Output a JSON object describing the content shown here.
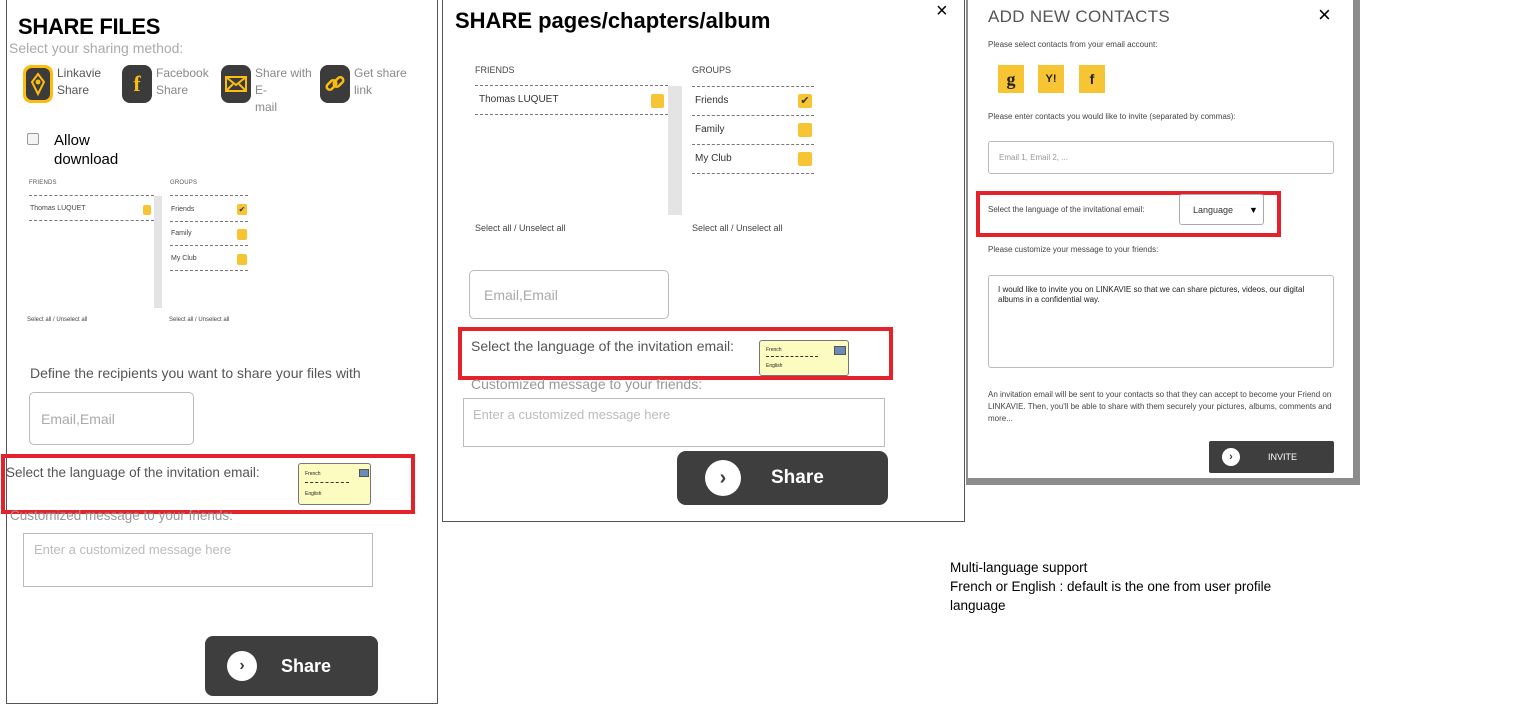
{
  "panel1": {
    "title": "SHARE FILES",
    "subtitle": "Select your sharing method:",
    "methods": [
      {
        "line1": "Linkavie",
        "line2": "Share",
        "icon": "linkavie-icon"
      },
      {
        "line1": "Facebook",
        "line2": "Share",
        "icon": "facebook-icon"
      },
      {
        "line1": "Share with E-",
        "line2": "mail",
        "icon": "email-icon"
      },
      {
        "line1": "Get share link",
        "line2": "",
        "icon": "link-icon"
      }
    ],
    "allow_line1": "Allow",
    "allow_line2": "download",
    "friends_header": "FRIENDS",
    "groups_header": "GROUPS",
    "friends": [
      "Thomas LUQUET"
    ],
    "groups": [
      "Friends",
      "Family",
      "My Club"
    ],
    "select_all_friends": "Select all / Unselect all",
    "select_all_groups": "Select all / Unselect all",
    "recipients_label": "Define the recipients you want to share your files with",
    "email_placeholder": "Email,Email",
    "language_label": "Select the language of the invitation email:",
    "lang_options": [
      "French",
      "English"
    ],
    "custom_label": "Customized message to your friends:",
    "message_placeholder": "Enter a customized message here",
    "share_label": "Share"
  },
  "panel2": {
    "title": "SHARE pages/chapters/album",
    "close": "×",
    "friends_header": "FRIENDS",
    "groups_header": "GROUPS",
    "friends": [
      "Thomas LUQUET"
    ],
    "groups": [
      "Friends",
      "Family",
      "My Club"
    ],
    "select_all_friends": "Select all /  Unselect all",
    "select_all_groups": "Select all /  Unselect all",
    "email_placeholder": "Email,Email",
    "language_label": "Select the language of the invitation email:",
    "lang_options": [
      "French",
      "English"
    ],
    "custom_label": "Customized message to your friends:",
    "message_placeholder": "Enter a customized message here",
    "share_label": "Share"
  },
  "panel3": {
    "title": "ADD NEW CONTACTS",
    "close": "×",
    "select_from_email": "Please select contacts from your email account:",
    "social": [
      "g",
      "Y!",
      "f"
    ],
    "enter_contacts": "Please enter contacts you would like to invite (separated by commas):",
    "contacts_placeholder": "Email 1, Email 2, ...",
    "language_label": "Select the language of the invitational email:",
    "language_select": "Language",
    "customize_label": "Please customize your message to your friends:",
    "message": "I would like to invite you on LINKAVIE so that we can share pictures, videos, our digital albums in a confidential way.",
    "note": "An invitation email will be sent to your contacts so that they can accept to become your Friend on LINKAVIE. Then, you'll be able to share with them securely your pictures, albums, comments and more...",
    "invite_label": "INVITE"
  },
  "annotation": {
    "line1": "Multi-language support",
    "line2": "French or English : default is the one from user profile",
    "line3": "language"
  },
  "colors": {
    "accent": "#f7c433",
    "highlight": "#e3222b",
    "button": "#3e3e3e"
  }
}
